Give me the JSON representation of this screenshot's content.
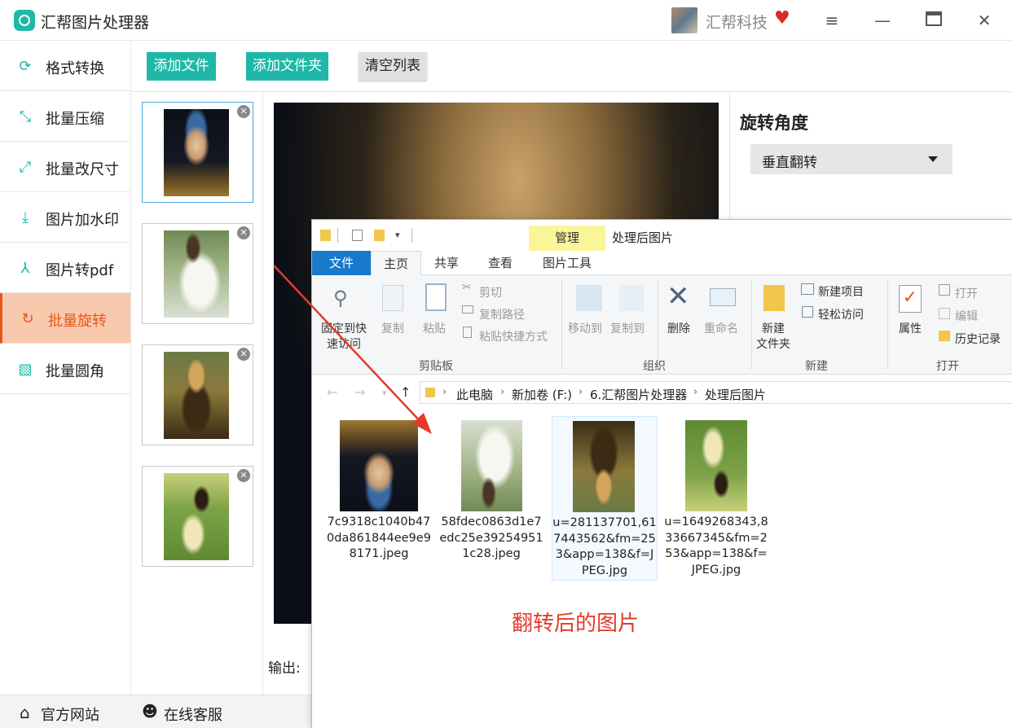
{
  "app": {
    "title": "汇帮图片处理器",
    "user_name": "汇帮科技",
    "accent": "#1fb8a8",
    "active_color": "#e5581f"
  },
  "sidebar": {
    "items": [
      {
        "label": "格式转换",
        "icon": "format-convert-icon"
      },
      {
        "label": "批量压缩",
        "icon": "compress-icon"
      },
      {
        "label": "批量改尺寸",
        "icon": "resize-icon"
      },
      {
        "label": "图片加水印",
        "icon": "watermark-icon"
      },
      {
        "label": "图片转pdf",
        "icon": "pdf-icon"
      },
      {
        "label": "批量旋转",
        "icon": "rotate-icon",
        "active": true
      },
      {
        "label": "批量圆角",
        "icon": "round-corner-icon"
      }
    ]
  },
  "toolbar": {
    "add_file": "添加文件",
    "add_folder": "添加文件夹",
    "clear_list": "清空列表"
  },
  "right_panel": {
    "title": "旋转角度",
    "selected": "垂直翻转"
  },
  "output_label": "输出:",
  "footer": {
    "official_site": "官方网站",
    "online_service": "在线客服"
  },
  "explorer": {
    "manage_tab": "管理",
    "window_title": "处理后图片",
    "tabs": [
      "文件",
      "主页",
      "共享",
      "查看",
      "图片工具"
    ],
    "ribbon": {
      "pin_line1": "固定到快",
      "pin_line2": "速访问",
      "copy": "复制",
      "paste": "粘贴",
      "cut": "剪切",
      "copy_path": "复制路径",
      "paste_shortcut": "粘贴快捷方式",
      "clipboard_group": "剪贴板",
      "move_to": "移动到",
      "copy_to": "复制到",
      "delete": "删除",
      "rename": "重命名",
      "organize_group": "组织",
      "new_folder_line1": "新建",
      "new_folder_line2": "文件夹",
      "new_item": "新建项目",
      "easy_access": "轻松访问",
      "new_group": "新建",
      "properties": "属性",
      "open": "打开",
      "edit": "编辑",
      "history": "历史记录",
      "open_group": "打开"
    },
    "breadcrumb": [
      "此电脑",
      "新加卷 (F:)",
      "6.汇帮图片处理器",
      "处理后图片"
    ],
    "files": [
      {
        "name": "7c9318c1040b470da861844ee9e98171.jpeg"
      },
      {
        "name": "58fdec0863d1e7edc25e392549511c28.jpeg"
      },
      {
        "name": "u=281137701,617443562&fm=253&app=138&f=JPEG.jpg"
      },
      {
        "name": "u=1649268343,833667345&fm=253&app=138&f=JPEG.jpg"
      }
    ],
    "caption": "翻转后的图片",
    "caption_color": "#e23b2b"
  }
}
